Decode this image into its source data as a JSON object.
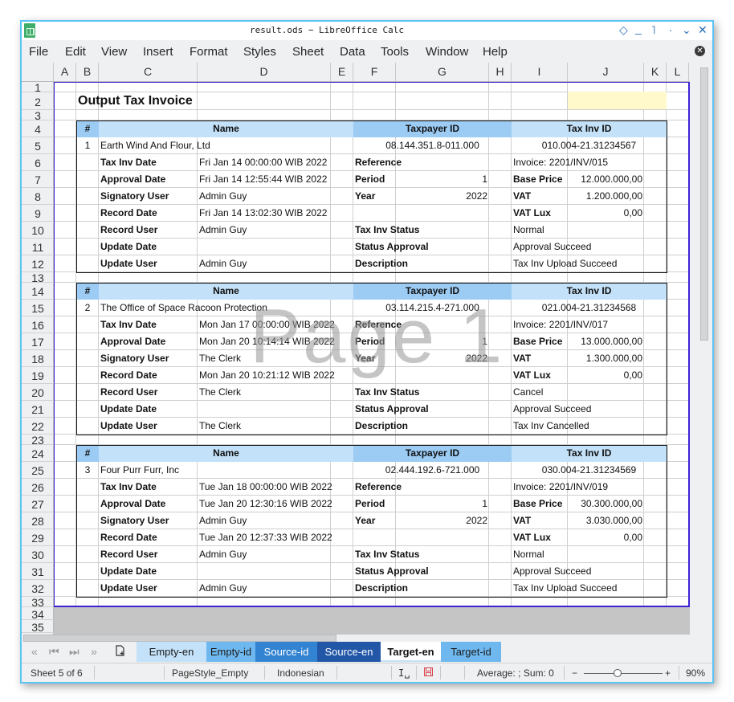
{
  "window": {
    "title": "result.ods − LibreOffice Calc",
    "controls": [
      "◇",
      "_",
      "˥",
      "·",
      "⌄",
      "✕"
    ]
  },
  "menu": [
    "File",
    "Edit",
    "View",
    "Insert",
    "Format",
    "Styles",
    "Sheet",
    "Data",
    "Tools",
    "Window",
    "Help"
  ],
  "columns": [
    "A",
    "B",
    "C",
    "D",
    "E",
    "F",
    "G",
    "H",
    "I",
    "J",
    "K",
    "L"
  ],
  "rows": [
    "1",
    "2",
    "3",
    "4",
    "5",
    "6",
    "7",
    "8",
    "9",
    "10",
    "11",
    "12",
    "13",
    "14",
    "15",
    "16",
    "17",
    "18",
    "19",
    "20",
    "21",
    "22",
    "23",
    "24",
    "25",
    "26",
    "27",
    "28",
    "29",
    "30",
    "31",
    "32",
    "33",
    "34",
    "35"
  ],
  "sheet": {
    "title": "Output Tax Invoice",
    "watermark": "Page 1",
    "headers": {
      "num": "#",
      "name": "Name",
      "taxpayer_id": "Taxpayer ID",
      "tax_inv_id": "Tax Inv ID"
    },
    "labels": {
      "tax_inv_date": "Tax Inv Date",
      "approval_date": "Approval Date",
      "signatory_user": "Signatory User",
      "record_date": "Record Date",
      "record_user": "Record User",
      "update_date": "Update Date",
      "update_user": "Update User",
      "reference": "Reference",
      "period": "Period",
      "year": "Year",
      "tax_inv_status": "Tax Inv Status",
      "status_approval": "Status Approval",
      "description": "Description",
      "base_price": "Base Price",
      "vat": "VAT",
      "vat_lux": "VAT Lux"
    },
    "invoices": [
      {
        "num": "1",
        "name": "Earth Wind And Flour, Ltd",
        "taxpayer_id": "08.144.351.8-011.000",
        "tax_inv_id": "010.004-21.31234567",
        "tax_inv_date": "Fri Jan 14 00:00:00 WIB 2022",
        "approval_date": "Fri Jan 14 12:55:44 WIB 2022",
        "signatory_user": "Admin Guy",
        "record_date": "Fri Jan 14 13:02:30 WIB 2022",
        "record_user": "Admin Guy",
        "update_date": "",
        "update_user": "Admin Guy",
        "reference": "Invoice: 2201/INV/015",
        "period": "1",
        "year": "2022",
        "base_price": "12.000.000,00",
        "vat": "1.200.000,00",
        "vat_lux": "0,00",
        "tax_inv_status": "Normal",
        "status_approval": "Approval Succeed",
        "description": "Tax Inv Upload Succeed"
      },
      {
        "num": "2",
        "name": "The Office of Space Racoon Protection",
        "taxpayer_id": "03.114.215.4-271.000",
        "tax_inv_id": "021.004-21.31234568",
        "tax_inv_date": "Mon Jan 17 00:00:00 WIB 2022",
        "approval_date": "Mon Jan 20 10:14:14 WIB 2022",
        "signatory_user": "The Clerk",
        "record_date": "Mon Jan 20 10:21:12 WIB 2022",
        "record_user": "The Clerk",
        "update_date": "",
        "update_user": "The Clerk",
        "reference": "Invoice: 2201/INV/017",
        "period": "1",
        "year": "2022",
        "base_price": "13.000.000,00",
        "vat": "1.300.000,00",
        "vat_lux": "0,00",
        "tax_inv_status": "Cancel",
        "status_approval": "Approval Succeed",
        "description": "Tax Inv Cancelled"
      },
      {
        "num": "3",
        "name": "Four Purr Furr, Inc",
        "taxpayer_id": "02.444.192.6-721.000",
        "tax_inv_id": "030.004-21.31234569",
        "tax_inv_date": "Tue Jan 18 00:00:00 WIB 2022",
        "approval_date": "Tue Jan 20 12:30:16 WIB 2022",
        "signatory_user": "Admin Guy",
        "record_date": "Tue Jan 20 12:37:33 WIB 2022",
        "record_user": "Admin Guy",
        "update_date": "",
        "update_user": "Admin Guy",
        "reference": "Invoice: 2201/INV/019",
        "period": "1",
        "year": "2022",
        "base_price": "30.300.000,00",
        "vat": "3.030.000,00",
        "vat_lux": "0,00",
        "tax_inv_status": "Normal",
        "status_approval": "Approval Succeed",
        "description": "Tax Inv Upload Succeed"
      }
    ]
  },
  "tabs": {
    "nav": [
      "«",
      "⏮",
      "⏭",
      "»"
    ],
    "add_icon": "🗋",
    "items": [
      {
        "label": "Empty-en",
        "bg": "#c3e1f8",
        "fg": "#1b1b1b"
      },
      {
        "label": "Empty-id",
        "bg": "#6fb8ef",
        "fg": "#1b1b1b"
      },
      {
        "label": "Source-id",
        "bg": "#3283d2",
        "fg": "#ffffff"
      },
      {
        "label": "Source-en",
        "bg": "#2257a8",
        "fg": "#ffffff"
      },
      {
        "label": "Target-en",
        "bg": "#ffffff",
        "fg": "#111111",
        "active": true
      },
      {
        "label": "Target-id",
        "bg": "#6fb8ef",
        "fg": "#1b1b1b"
      }
    ]
  },
  "status": {
    "sheet": "Sheet 5 of 6",
    "page_style": "PageStyle_Empty",
    "language": "Indonesian",
    "selection_mode": "I␣",
    "save_icon": "💾",
    "summary": "Average: ; Sum: 0",
    "zoom_minus": "−",
    "zoom_plus": "+",
    "zoom": "90%"
  },
  "colors": {
    "page_border": "#3d22d6",
    "header_light": "#c3e1f8",
    "header_dark": "#9ccbf4",
    "highlight_yellow": "#fff9cc"
  }
}
